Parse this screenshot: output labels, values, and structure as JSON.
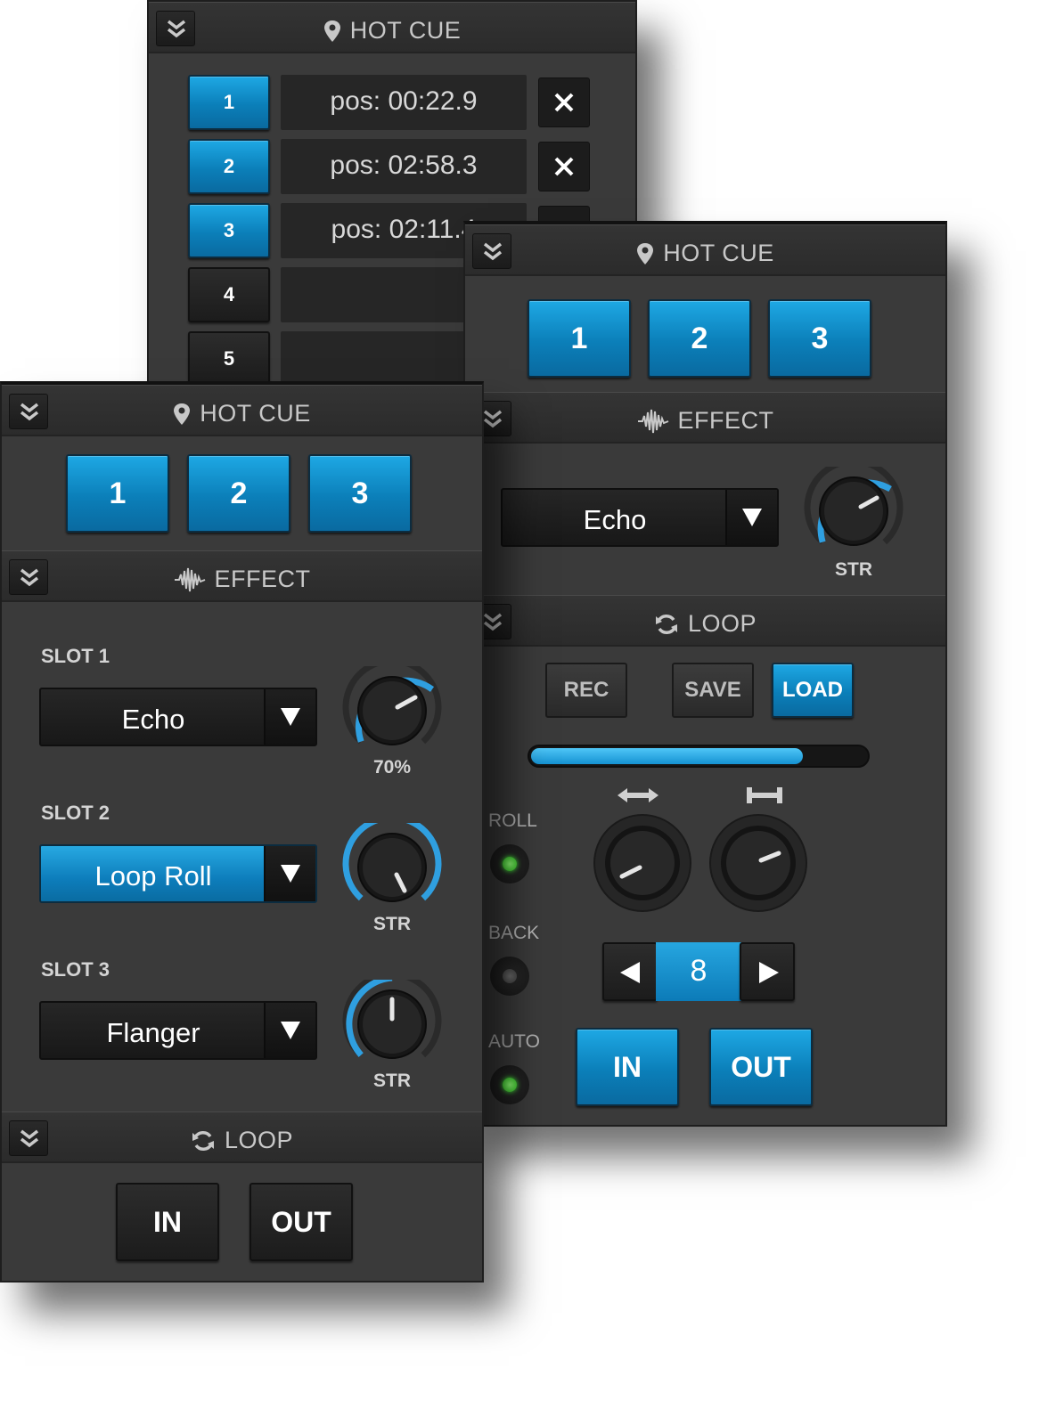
{
  "panel_a": {
    "header_title": "HOT CUE",
    "cues": [
      {
        "number": "1",
        "position": "pos: 00:22.9",
        "state": "set"
      },
      {
        "number": "2",
        "position": "pos: 02:58.3",
        "state": "set"
      },
      {
        "number": "3",
        "position": "pos: 02:11.4",
        "state": "set"
      },
      {
        "number": "4",
        "position": "",
        "state": "empty"
      },
      {
        "number": "5",
        "position": "",
        "state": "empty"
      }
    ]
  },
  "panel_b": {
    "hotcue_title": "HOT CUE",
    "hotcue_buttons": [
      "1",
      "2",
      "3"
    ],
    "effect_title": "EFFECT",
    "effect_dropdown": "Echo",
    "effect_knob_label": "STR",
    "loop_title": "LOOP",
    "rec_label": "REC",
    "save_label": "SAVE",
    "load_label": "LOAD",
    "loop_progress": 0.81,
    "roll_label": "ROLL",
    "back_label": "BACK",
    "auto_label": "AUTO",
    "roll_on": true,
    "back_on": false,
    "auto_on": true,
    "loop_length": "8",
    "in_label": "IN",
    "out_label": "OUT"
  },
  "panel_c": {
    "hotcue_title": "HOT CUE",
    "hotcue_buttons": [
      "1",
      "2",
      "3"
    ],
    "effect_title": "EFFECT",
    "slots": [
      {
        "label": "SLOT 1",
        "effect": "Echo",
        "knob_label": "70%",
        "active": false
      },
      {
        "label": "SLOT 2",
        "effect": "Loop Roll",
        "knob_label": "STR",
        "active": true
      },
      {
        "label": "SLOT 3",
        "effect": "Flanger",
        "knob_label": "STR",
        "active": false
      }
    ],
    "loop_title": "LOOP",
    "in_label": "IN",
    "out_label": "OUT"
  },
  "colors": {
    "accent_blue": "#1a9fdc",
    "panel_bg": "#3a3a3a",
    "header_bg": "#2e2e2e",
    "led_green": "#3fd12b"
  }
}
